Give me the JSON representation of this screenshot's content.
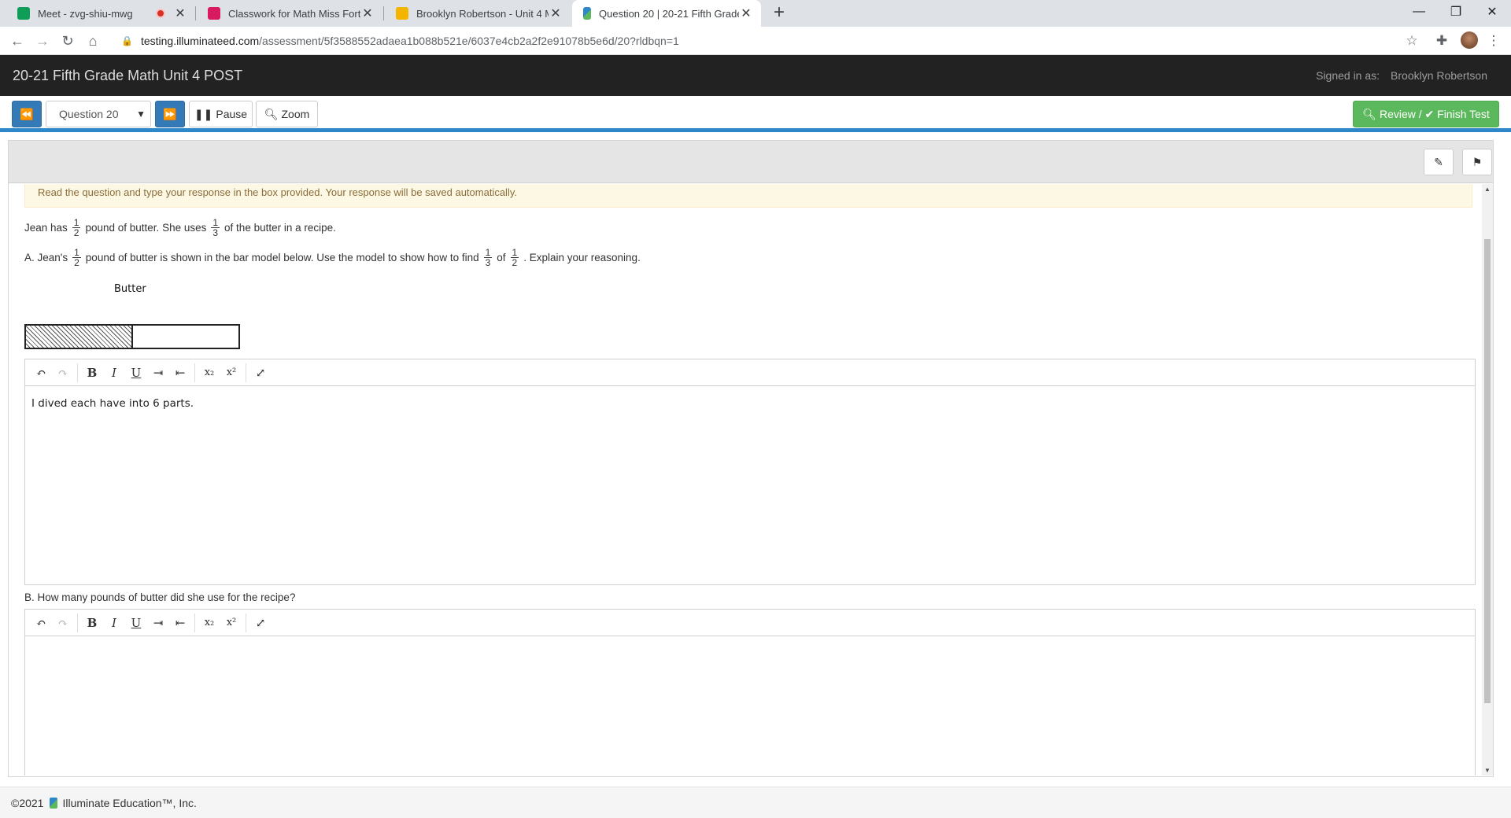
{
  "browser": {
    "tabs": [
      {
        "title": "Meet - zvg-shiu-mwg",
        "color": "#0f9d58"
      },
      {
        "title": "Classwork for Math Miss Fortino",
        "color": "#d81b60"
      },
      {
        "title": "Brooklyn Robertson - Unit 4 Math",
        "color": "#f4b400"
      },
      {
        "title": "Question 20 | 20-21 Fifth Grade Math Unit 4 POST",
        "color": "#2e87c9"
      }
    ],
    "url_host": "testing.illuminateed.com",
    "url_path": "/assessment/5f3588552adaea1b088b521e/6037e4cb2a2f2e91078b5e6d/20?rldbqn=1"
  },
  "app": {
    "title": "20-21 Fifth Grade Math Unit 4 POST",
    "signed_in_label": "Signed in as:",
    "signed_in_name": "Brooklyn Robertson"
  },
  "toolbar": {
    "question_select": "Question 20",
    "pause_label": "Pause",
    "zoom_label": "Zoom",
    "review_label": "Review / ✔ Finish Test"
  },
  "question": {
    "instructions": "Read the question and type your response in the box provided. Your response will be saved automatically.",
    "line1": {
      "a": "Jean has",
      "f1_num": "1",
      "f1_den": "2",
      "b": "pound of butter. She uses",
      "f2_num": "1",
      "f2_den": "3",
      "c": "of the butter in a recipe."
    },
    "line2": {
      "a": "A. Jean's",
      "f1_num": "1",
      "f1_den": "2",
      "b": "pound of butter is shown in the bar model below. Use the model to show how to find",
      "f2_num": "1",
      "f2_den": "3",
      "c": "of",
      "f3_num": "1",
      "f3_den": "2",
      "d": ". Explain your reasoning."
    },
    "bar_label": "Butter",
    "bar_model": {
      "parts": 2,
      "shaded_parts": 1
    },
    "answer_a": "I dived each have into 6 parts.",
    "part_b": "B. How many pounds of butter did she use for the recipe?",
    "answer_b": ""
  },
  "footer": {
    "copyright": "©2021",
    "company": "Illuminate Education™, Inc."
  }
}
